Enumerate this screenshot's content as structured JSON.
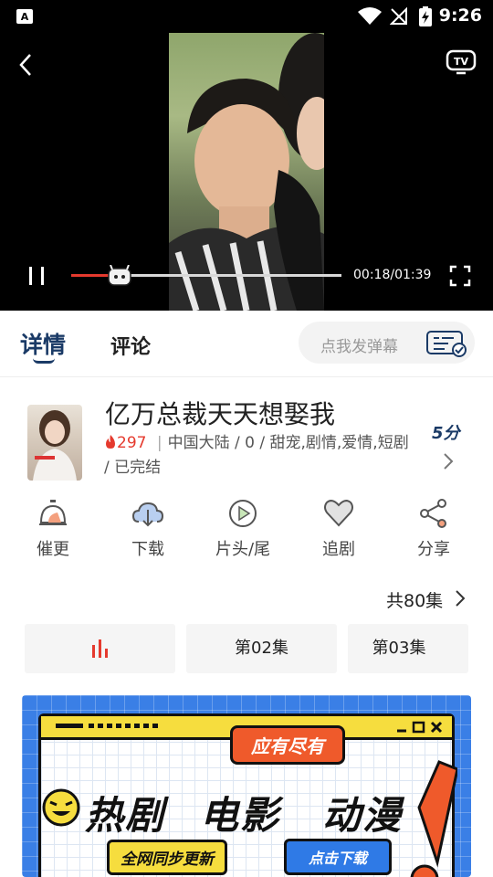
{
  "status_bar": {
    "time": "9:26"
  },
  "player": {
    "elapsed_total": "00:18/01:39",
    "progress_fraction": 0.18,
    "tv_label": "TV"
  },
  "tabs": {
    "detail": "详情",
    "comments": "评论",
    "danmaku_placeholder": "点我发弹幕"
  },
  "drama": {
    "title": "亿万总裁天天想娶我",
    "heat": "297",
    "meta_rest": "中国大陆 / 0 / 甜宠,剧情,爱情,短剧 / 已完结",
    "meta_sep": "|",
    "rating": "5分"
  },
  "actions": [
    {
      "label": "催更",
      "icon": "alarm-bell-icon"
    },
    {
      "label": "下载",
      "icon": "cloud-download-icon"
    },
    {
      "label": "片头/尾",
      "icon": "play-circle-icon"
    },
    {
      "label": "追剧",
      "icon": "heart-icon"
    },
    {
      "label": "分享",
      "icon": "share-icon"
    }
  ],
  "episodes": {
    "total": "共80集",
    "items": [
      "第02集",
      "第03集"
    ]
  },
  "banner": {
    "tag": "应有尽有",
    "word1": "热剧",
    "word2": "电影",
    "word3": "动漫",
    "sync": "全网同步更新",
    "download": "点击下载"
  },
  "colors": {
    "accent": "#e53a2e",
    "brand": "#1a3a66",
    "banner_blue": "#3a7fe6"
  }
}
